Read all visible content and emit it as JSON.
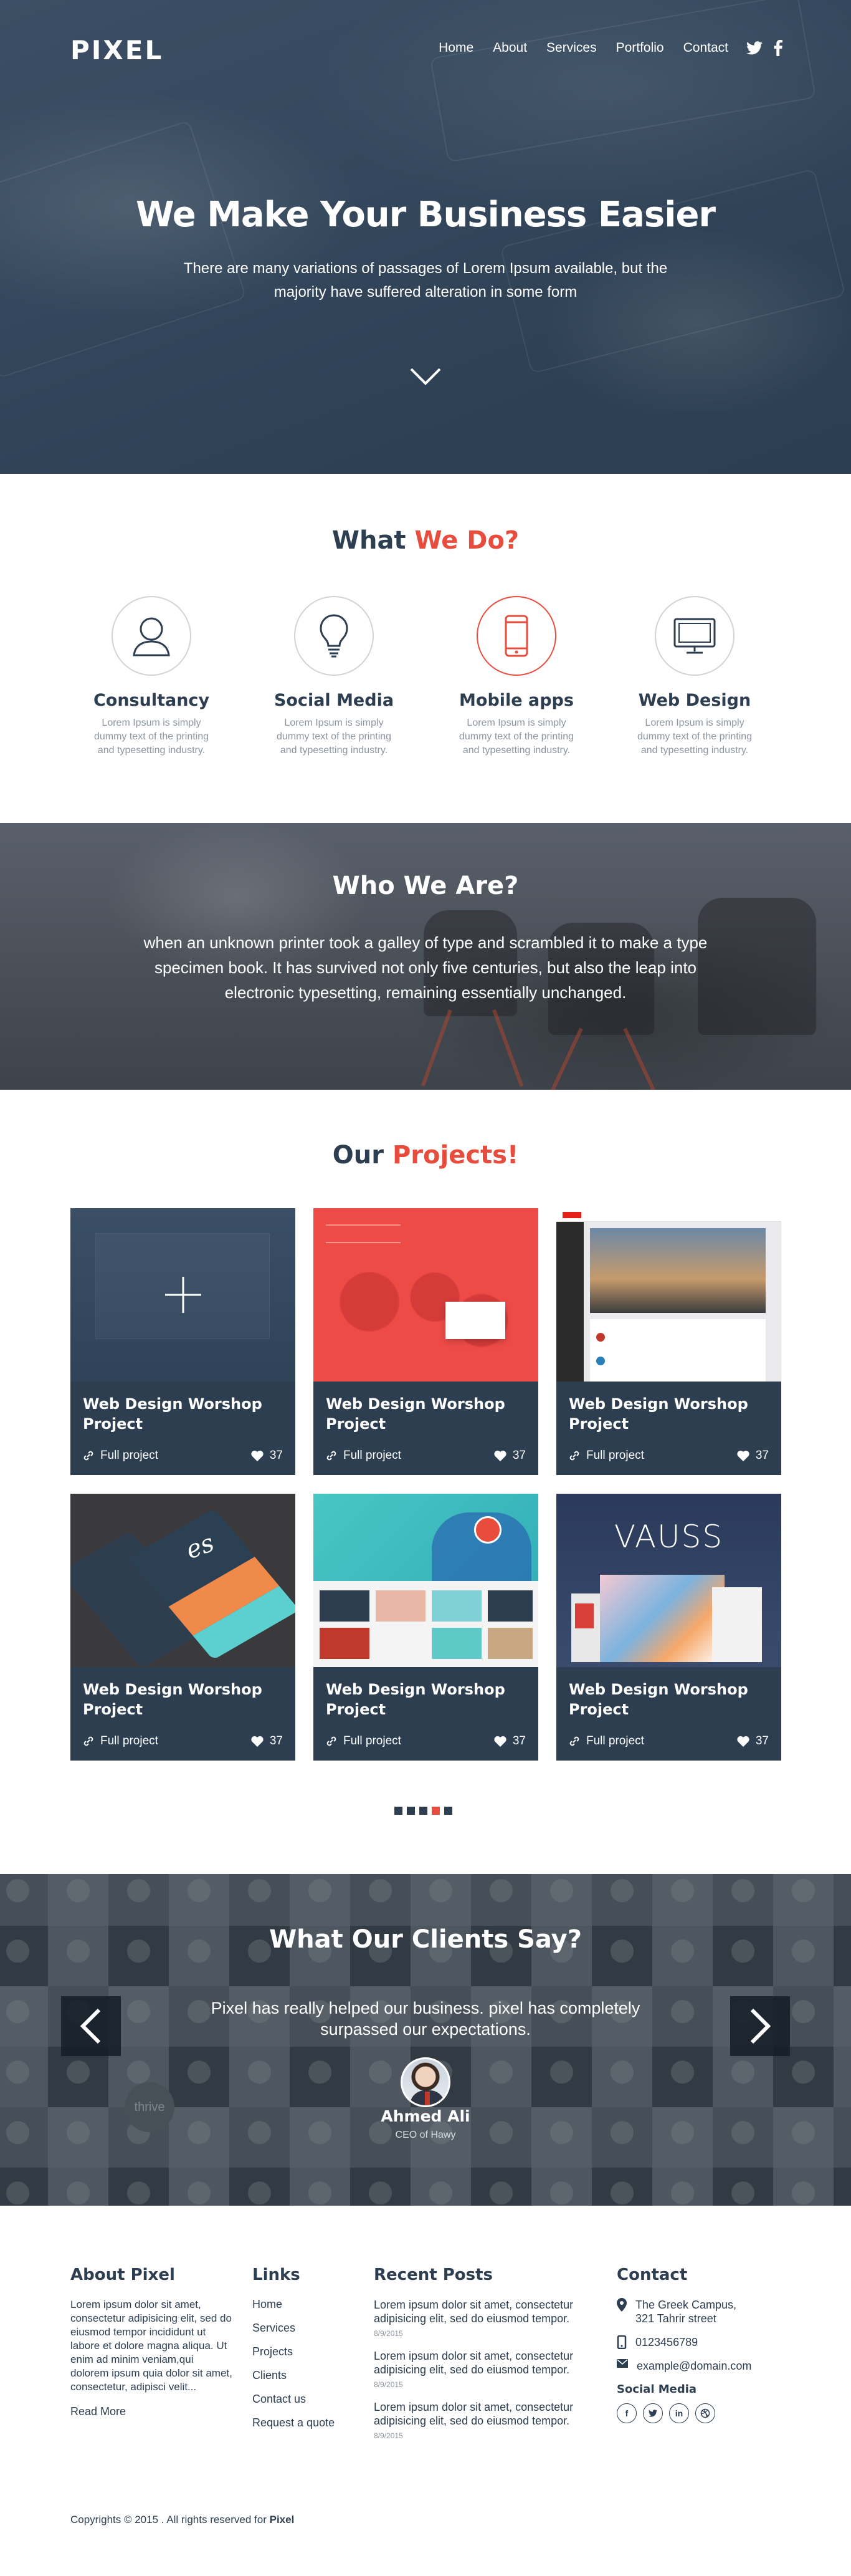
{
  "brand": {
    "logo": "PIXEL",
    "accent_color": "#e74c3c",
    "dark_color": "#2c3e50"
  },
  "nav": {
    "items": [
      "Home",
      "About",
      "Services",
      "Portfolio",
      "Contact"
    ],
    "social_icons": [
      "twitter-icon",
      "facebook-icon"
    ]
  },
  "hero": {
    "title": "We Make Your Business Easier",
    "subtitle": "There are many variations of passages of Lorem Ipsum available, but the majority have suffered alteration in some form"
  },
  "what_we_do": {
    "title_prefix": "What",
    "title_accent": "We Do?",
    "services": [
      {
        "title": "Consultancy",
        "text": "Lorem Ipsum is simply dummy text of the printing and typesetting industry.",
        "icon": "user-icon"
      },
      {
        "title": "Social Media",
        "text": "Lorem Ipsum is simply dummy text of the printing and typesetting industry.",
        "icon": "lightbulb-icon"
      },
      {
        "title": "Mobile apps",
        "text": "Lorem Ipsum is simply dummy text of the printing and typesetting industry.",
        "icon": "smartphone-icon"
      },
      {
        "title": "Web Design",
        "text": "Lorem Ipsum is simply dummy text of the printing and typesetting industry.",
        "icon": "monitor-icon"
      }
    ]
  },
  "who_we_are": {
    "title": "Who We Are?",
    "text": "when an unknown printer took a galley of type and scrambled it to make a type specimen book. It has survived not only five centuries, but also the leap into electronic typesetting, remaining essentially unchanged."
  },
  "projects": {
    "title_prefix": "Our",
    "title_accent": "Projects!",
    "items": [
      {
        "title": "Web Design Worshop Project",
        "link": "Full project",
        "likes": "37"
      },
      {
        "title": "Web Design Worshop Project",
        "link": "Full project",
        "likes": "37"
      },
      {
        "title": "Web Design Worshop Project",
        "link": "Full project",
        "likes": "37"
      },
      {
        "title": "Web Design Worshop Project",
        "link": "Full project",
        "likes": "37"
      },
      {
        "title": "Web Design Worshop Project",
        "link": "Full project",
        "likes": "37"
      },
      {
        "title": "Web Design Worshop Project",
        "link": "Full project",
        "likes": "37"
      }
    ],
    "thumb_texts": {
      "vauss": "VAUSS",
      "es": "es"
    },
    "pagination": {
      "count": 5,
      "active_index": 3
    }
  },
  "testimonials": {
    "title": "What Our Clients Say?",
    "quote": "Pixel has really helped our business. pixel has completely surpassed our expectations.",
    "name": "Ahmed Ali",
    "role": "CEO of Hawy",
    "tile_labels": {
      "thrive": "thrive"
    }
  },
  "footer": {
    "about": {
      "title": "About Pixel",
      "text": "Lorem ipsum dolor sit amet, consectetur adipisicing elit, sed do eiusmod tempor incididunt ut labore et dolore magna aliqua. Ut enim ad minim veniam,qui dolorem ipsum quia dolor sit amet, consectetur, adipisci velit...",
      "read_more": "Read More"
    },
    "links": {
      "title": "Links",
      "items": [
        "Home",
        "Services",
        "Projects",
        "Clients",
        "Contact us",
        "Request a quote"
      ]
    },
    "recent_posts": {
      "title": "Recent Posts",
      "items": [
        {
          "text": "Lorem ipsum dolor sit amet, consectetur adipisicing elit, sed do eiusmod tempor.",
          "date": "8/9/2015"
        },
        {
          "text": "Lorem ipsum dolor sit amet, consectetur adipisicing elit, sed do eiusmod tempor.",
          "date": "8/9/2015"
        },
        {
          "text": "Lorem ipsum dolor sit amet, consectetur adipisicing elit, sed do eiusmod tempor.",
          "date": "8/9/2015"
        }
      ]
    },
    "contact": {
      "title": "Contact",
      "address": "The Greek  Campus, 321 Tahrir street",
      "phone": "0123456789",
      "email": "example@domain.com",
      "social_title": "Social Media",
      "social": [
        "f",
        "t",
        "in",
        "d"
      ]
    },
    "copyright_prefix": "Copyrights © 2015 . All rights reserved for",
    "copyright_brand": "Pixel"
  }
}
